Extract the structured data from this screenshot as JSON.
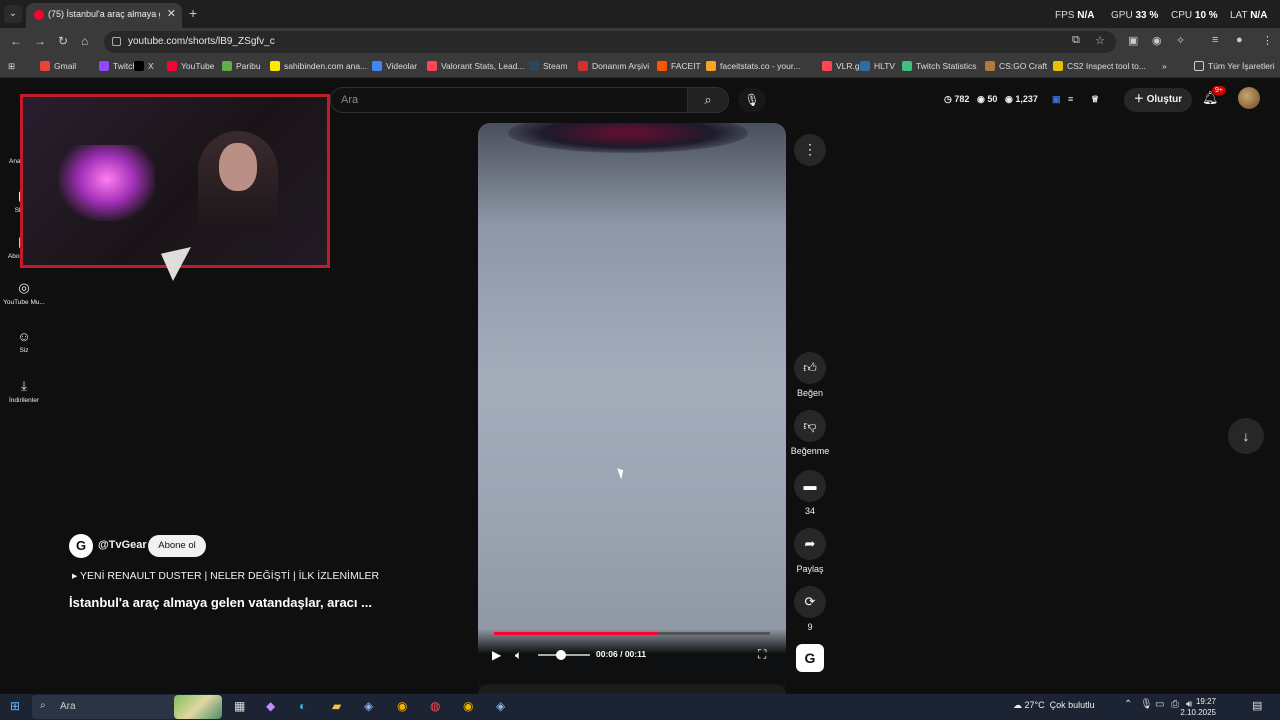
{
  "browser": {
    "tab_title": "(75) İstanbul'a araç almaya gele",
    "tab_dropdown": "⌄",
    "tab_close": "✕",
    "new_tab": "+",
    "url": "youtube.com/shorts/lB9_ZSgfv_c",
    "overlay_stats": {
      "fps_label": "FPS",
      "fps_value": "N/A",
      "gpu_label": "GPU",
      "gpu_value": "33 %",
      "cpu_label": "CPU",
      "cpu_value": "10 %",
      "lat_label": "LAT",
      "lat_value": "N/A"
    },
    "bookmarks": [
      {
        "label": "Gmail",
        "color": "#ea4335"
      },
      {
        "label": "Twitch",
        "color": "#9146ff"
      },
      {
        "label": "X",
        "color": "#000000"
      },
      {
        "label": "YouTube",
        "color": "#ff0033"
      },
      {
        "label": "Paribu",
        "color": "#5fb04a"
      },
      {
        "label": "sahibinden.com ana...",
        "color": "#ffe800"
      },
      {
        "label": "Videolar",
        "color": "#4285f4"
      },
      {
        "label": "Valorant Stats, Lead...",
        "color": "#ff4655"
      },
      {
        "label": "Steam",
        "color": "#2a475e"
      },
      {
        "label": "Donanım Arşivi",
        "color": "#d32f2f"
      },
      {
        "label": "FACEIT",
        "color": "#ff5500"
      },
      {
        "label": "faceitstats.co - your...",
        "color": "#f5a623"
      },
      {
        "label": "VLR.gg",
        "color": "#ff4655"
      },
      {
        "label": "HLTV",
        "color": "#2d6da3"
      },
      {
        "label": "Twitch Statistics",
        "color": "#3fbf7f"
      },
      {
        "label": "CS:GO Craft",
        "color": "#b07a3a"
      },
      {
        "label": "CS2 Inspect tool to...",
        "color": "#e6c200"
      }
    ],
    "bookmarks_more": "»",
    "all_bookmarks": "Tüm Yer İşaretleri"
  },
  "youtube": {
    "search_placeholder": "Ara",
    "header_stats": {
      "a": "782",
      "b": "50",
      "c": "1,237"
    },
    "create_label": "Oluştur",
    "notif_count": "9+",
    "sidebar": [
      {
        "label": "Ana Sayfa",
        "icon": "home-icon"
      },
      {
        "label": "Shorts",
        "icon": "shorts-icon"
      },
      {
        "label": "Abonelikler",
        "icon": "subscriptions-icon"
      },
      {
        "label": "YouTube Mu...",
        "icon": "music-icon"
      },
      {
        "label": "Siz",
        "icon": "user-icon"
      },
      {
        "label": "İndirilenler",
        "icon": "download-icon"
      }
    ],
    "actions": {
      "like_label": "Beğen",
      "dislike_label": "Beğenme",
      "comments_count": "34",
      "share_label": "Paylaş",
      "remix_count": "9"
    },
    "player": {
      "time": "00:06 / 00:11",
      "progress": 0.59,
      "volume": 0.4
    },
    "channel": {
      "name": "@TvGear",
      "subscribe_label": "Abone ol",
      "playlist": "YENİ RENAULT DUSTER | NELER DEĞİŞTİ | İLK İZLENİMLER",
      "video_title": "İstanbul'a araç almaya gelen vatandaşlar, aracı ..."
    }
  },
  "taskbar": {
    "search_placeholder": "Ara",
    "weather_temp": "27°C",
    "weather_desc": "Çok bulutlu",
    "time": "19:27",
    "date": "2.10.2025"
  },
  "colors": {
    "accent_red": "#ff0033",
    "frame_red": "#c21c2a"
  }
}
